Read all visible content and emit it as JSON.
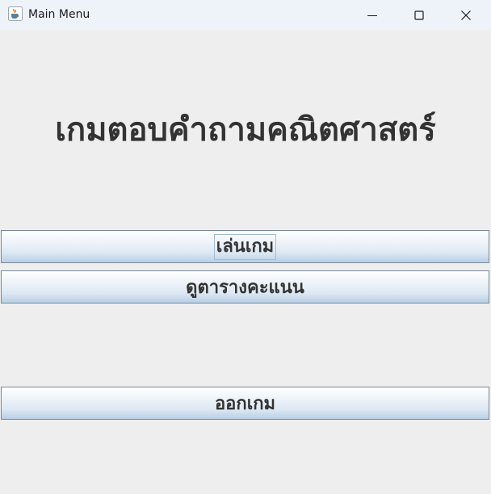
{
  "window": {
    "title": "Main Menu",
    "app_icon": "java-cup-icon",
    "controls": {
      "minimize": "minimize-icon",
      "maximize": "maximize-icon",
      "close": "close-icon"
    }
  },
  "main": {
    "heading": "เกมตอบคำถามคณิตศาสตร์",
    "buttons": {
      "play": "เล่นเกม",
      "scoreboard": "ดูตารางคะแนน",
      "exit": "ออกเกม"
    }
  },
  "colors": {
    "background": "#eeeeee",
    "titlebar": "#eef3fa",
    "text": "#333333"
  }
}
